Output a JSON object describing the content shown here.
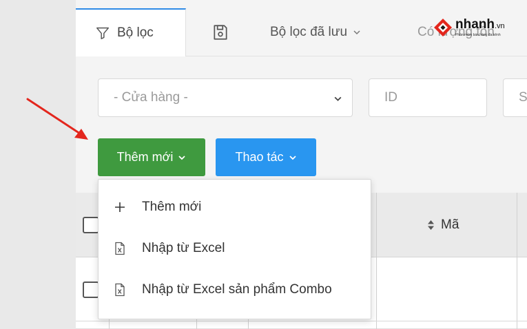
{
  "tabs": {
    "filter_label": "Bộ lọc",
    "saved_label": "Bộ lọc đã lưu",
    "more_label": "Có lượng tồn"
  },
  "filters": {
    "store_placeholder": "- Cửa hàng -",
    "id_placeholder": "ID",
    "s_placeholder": "S"
  },
  "buttons": {
    "add_label": "Thêm mới",
    "action_label": "Thao tác"
  },
  "table": {
    "col_code": "Mã"
  },
  "menu": {
    "items": [
      {
        "label": "Thêm mới",
        "icon": "plus-icon"
      },
      {
        "label": "Nhập từ Excel",
        "icon": "excel-file-icon"
      },
      {
        "label": "Nhập từ Excel sản phẩm Combo",
        "icon": "excel-file-icon"
      }
    ]
  },
  "logo": {
    "brand": "nhanh",
    "suffix": ".vn",
    "tagline": "Phần mềm bán hàng đa kênh"
  },
  "colors": {
    "add_button": "#3f9a3f",
    "action_button": "#2996f0",
    "active_tab_border": "#2e8ae6",
    "annotation_arrow": "#e3261d",
    "logo_accent": "#e3261d"
  }
}
